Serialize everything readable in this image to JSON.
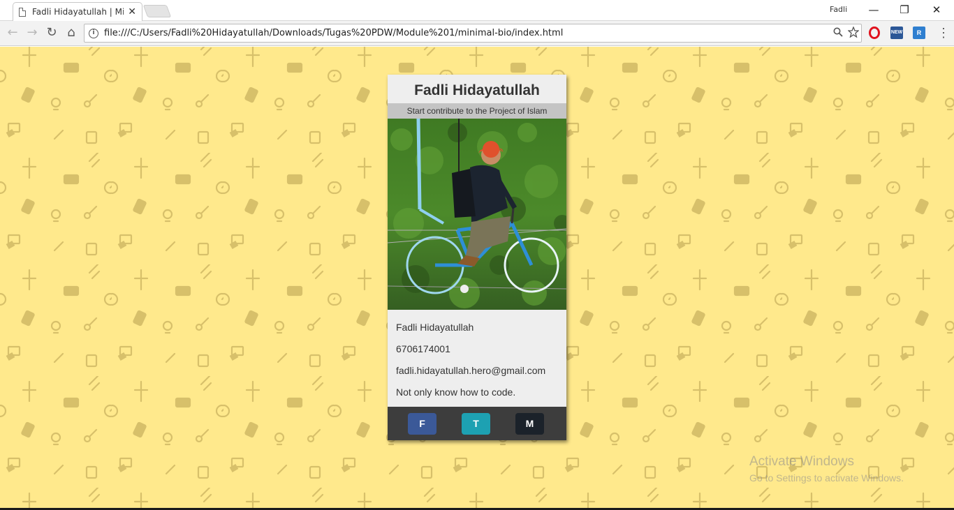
{
  "browser": {
    "tab_title": "Fadli Hidayatullah | Minimal Bio",
    "tab_close": "✕",
    "profile_name": "Fadli",
    "url": "file:///C:/Users/Fadli%20Hidayatullah/Downloads/Tugas%20PDW/Module%201/minimal-bio/index.html",
    "controls": {
      "minimize": "—",
      "restore": "❐",
      "close": "✕"
    },
    "nav": {
      "back": "←",
      "forward": "→",
      "reload": "↻",
      "home": "⌂"
    },
    "extensions": [
      {
        "name": "opera-icon",
        "label": "O",
        "color": "#e0121e"
      },
      {
        "name": "new-extension-icon",
        "label": "NEW",
        "color": "#2b5797"
      },
      {
        "name": "r-extension-icon",
        "label": "R",
        "color": "#2f7fd0"
      }
    ]
  },
  "page": {
    "background_color": "#ffe98c",
    "card": {
      "name": "Fadli Hidayatullah",
      "tagline": "Start contribute to the Project of Islam",
      "details": {
        "fullname": "Fadli Hidayatullah",
        "phone": "6706174001",
        "email": "fadli.hidayatullah.hero@gmail.com",
        "motto": "Not only know how to code."
      },
      "social": [
        {
          "label": "F",
          "color": "#3b5998",
          "name": "facebook-button"
        },
        {
          "label": "T",
          "color": "#1da1b2",
          "name": "twitter-button"
        },
        {
          "label": "M",
          "color": "#1b222a",
          "name": "medium-button"
        }
      ]
    }
  },
  "watermark": {
    "line1": "Activate Windows",
    "line2": "Go to Settings to activate Windows."
  }
}
